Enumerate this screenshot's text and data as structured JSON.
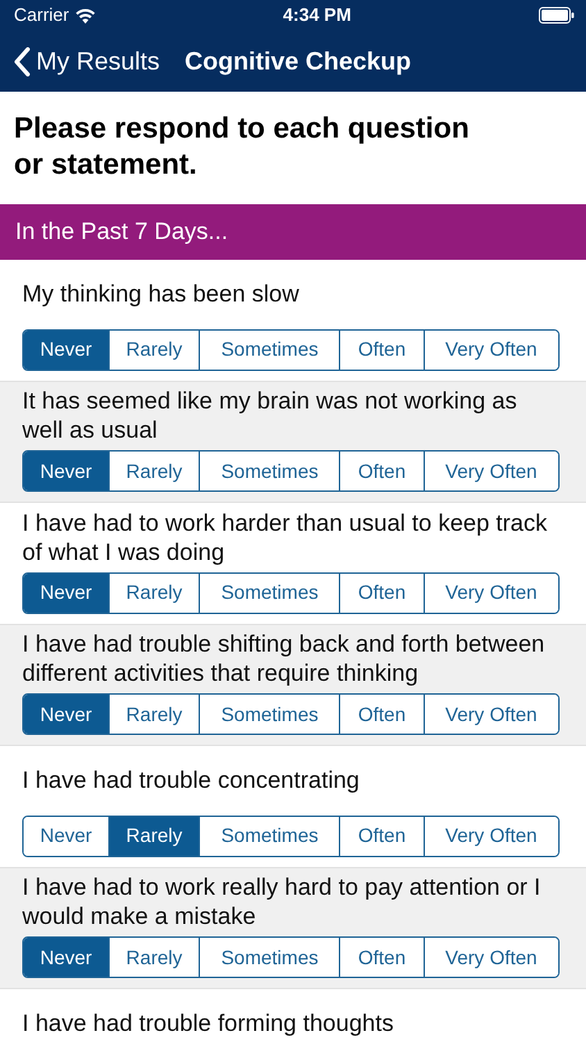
{
  "status_bar": {
    "carrier": "Carrier",
    "time": "4:34 PM"
  },
  "nav": {
    "back": "My Results",
    "title": "Cognitive Checkup"
  },
  "instruction": "Please respond to each question or statement.",
  "section": "In the Past 7 Days...",
  "questions": [
    {
      "text": "My thinking has been slow",
      "options": [
        {
          "label": "Never",
          "selected": true
        },
        {
          "label": "Rarely",
          "selected": false
        },
        {
          "label": "Sometimes",
          "selected": false
        },
        {
          "label": "Often",
          "selected": false
        },
        {
          "label": "Very Often",
          "selected": false
        }
      ]
    },
    {
      "text": "It has seemed like my brain was not working as well as usual",
      "options": [
        {
          "label": "Never",
          "selected": true
        },
        {
          "label": "Rarely",
          "selected": false
        },
        {
          "label": "Sometimes",
          "selected": false
        },
        {
          "label": "Often",
          "selected": false
        },
        {
          "label": "Very Often",
          "selected": false
        }
      ]
    },
    {
      "text": "I have had to work harder than usual to keep track of what I was doing",
      "options": [
        {
          "label": "Never",
          "selected": true
        },
        {
          "label": "Rarely",
          "selected": false
        },
        {
          "label": "Sometimes",
          "selected": false
        },
        {
          "label": "Often",
          "selected": false
        },
        {
          "label": "Very Often",
          "selected": false
        }
      ]
    },
    {
      "text": "I have had trouble shifting back and forth between different activities that require thinking",
      "options": [
        {
          "label": "Never",
          "selected": true
        },
        {
          "label": "Rarely",
          "selected": false
        },
        {
          "label": "Sometimes",
          "selected": false
        },
        {
          "label": "Often",
          "selected": false
        },
        {
          "label": "Very Often",
          "selected": false
        }
      ]
    },
    {
      "text": "I have had trouble concentrating",
      "options": [
        {
          "label": "Never",
          "selected": false
        },
        {
          "label": "Rarely",
          "selected": true
        },
        {
          "label": "Sometimes",
          "selected": false
        },
        {
          "label": "Often",
          "selected": false
        },
        {
          "label": "Very Often",
          "selected": false
        }
      ]
    },
    {
      "text": "I have had to work really hard to pay attention or I would make a mistake",
      "options": [
        {
          "label": "Never",
          "selected": true
        },
        {
          "label": "Rarely",
          "selected": false
        },
        {
          "label": "Sometimes",
          "selected": false
        },
        {
          "label": "Often",
          "selected": false
        },
        {
          "label": "Very Often",
          "selected": false
        }
      ]
    },
    {
      "text": "I have had trouble forming thoughts"
    }
  ]
}
